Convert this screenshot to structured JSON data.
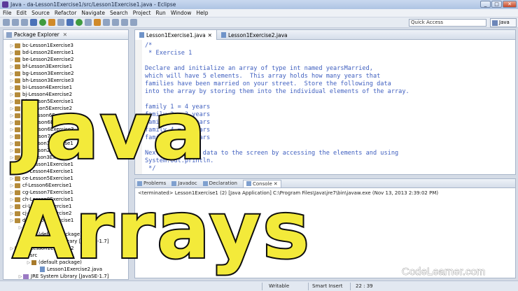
{
  "window": {
    "title": "Java - da-Lesson1Exercise1/src/Lesson1Exercise1.java - Eclipse",
    "buttons": [
      "_",
      "□",
      "✕"
    ]
  },
  "menu": [
    "File",
    "Edit",
    "Source",
    "Refactor",
    "Navigate",
    "Search",
    "Project",
    "Run",
    "Window",
    "Help"
  ],
  "toolbar": {
    "quick_access": "Quick Access",
    "perspective": "Java"
  },
  "package_explorer": {
    "title": "Package Explorer",
    "close": "✕",
    "items": [
      {
        "label": "bc-Lesson1Exercise3",
        "type": "project"
      },
      {
        "label": "bd-Lesson2Exercise1",
        "type": "project"
      },
      {
        "label": "be-Lesson2Exercise2",
        "type": "project"
      },
      {
        "label": "bf-Lesson3Exercise1",
        "type": "project"
      },
      {
        "label": "bg-Lesson3Exercise2",
        "type": "project"
      },
      {
        "label": "bh-Lesson3Exercise3",
        "type": "project"
      },
      {
        "label": "bi-Lesson4Exercise1",
        "type": "project"
      },
      {
        "label": "bj-Lesson4Exercise2",
        "type": "project"
      },
      {
        "label": "bk-Lesson5Exercise1",
        "type": "project"
      },
      {
        "label": "bl-Lesson5Exercise2",
        "type": "project"
      },
      {
        "label": "bm-Lesson6Exercise1",
        "type": "project"
      },
      {
        "label": "bn-Lesson6Exercise2",
        "type": "project"
      },
      {
        "label": "bo-Lesson6Exercise3",
        "type": "project"
      },
      {
        "label": "bp-Lesson7Exercise1",
        "type": "project"
      },
      {
        "label": "ca-Lesson1Exercise1",
        "type": "project"
      },
      {
        "label": "cb-Lesson2Exercise1",
        "type": "project"
      },
      {
        "label": "cc-Lesson3Exercise1",
        "type": "project"
      },
      {
        "label": "cd-Lesson1Exercise1",
        "type": "project"
      },
      {
        "label": "ce-Lesson4Exercise1",
        "type": "project"
      },
      {
        "label": "ce-Lesson5Exercise1",
        "type": "project"
      },
      {
        "label": "cf-Lesson6Exercise1",
        "type": "project"
      },
      {
        "label": "cg-Lesson7Exercise1",
        "type": "project"
      },
      {
        "label": "ch-Lesson8Exercise1",
        "type": "project"
      },
      {
        "label": "ci-Lesson9Exercise1",
        "type": "project"
      },
      {
        "label": "cj-Lesson9Exercise2",
        "type": "project"
      },
      {
        "label": "da-Lesson1Exercise1",
        "type": "project"
      },
      {
        "label": "src",
        "type": "folder"
      },
      {
        "label": "(default package)",
        "type": "package"
      },
      {
        "label": "JRE System Library [JavaSE-1.7]",
        "type": "library"
      },
      {
        "label": "db-Lesson1Exercise2",
        "type": "project"
      },
      {
        "label": "src",
        "type": "folder"
      },
      {
        "label": "(default package)",
        "type": "package"
      },
      {
        "label": "Lesson1Exercise2.java",
        "type": "file"
      },
      {
        "label": "JRE System Library [JavaSE-1.7]",
        "type": "library"
      }
    ]
  },
  "editor": {
    "tabs": [
      {
        "label": "Lesson1Exercise1.java",
        "close": "✕"
      },
      {
        "label": "Lesson1Exercise2.java",
        "close": ""
      }
    ],
    "code": "/*\n * Exercise 1\n\nDeclare and initialize an array of type int named yearsMarried,\nwhich will have 5 elements.  This array holds how many years that\nfamilies have been married on your street.  Store the following data\ninto the array by storing them into the individual elements of the array.\n\nfamily 1 = 4 years\nfamily 2 = 3 years\nfamily 3 = 5 years\nfamily 4 = 6 years\nfamily 5 = 8 years\n\nNext, print the data to the screen by accessing the elements and using\nSystem.out.println.\n */"
  },
  "console": {
    "tabs": [
      "Problems",
      "Javadoc",
      "Declaration",
      "Console"
    ],
    "console_close": "✕",
    "line": "<terminated> Lesson1Exercise1 (2) [Java Application] C:\\Program Files\\Java\\jre7\\bin\\javaw.exe (Nov 13, 2013 2:39:02 PM)"
  },
  "status": {
    "writable": "Writable",
    "insert": "Smart Insert",
    "position": "22 : 39"
  },
  "overlay": {
    "line1": "Java",
    "line2": "Arrays"
  },
  "brand": "CodeLearner.com",
  "colors": {
    "overlay_text": "#f3ea3a",
    "comment_text": "#3f5fbf"
  }
}
